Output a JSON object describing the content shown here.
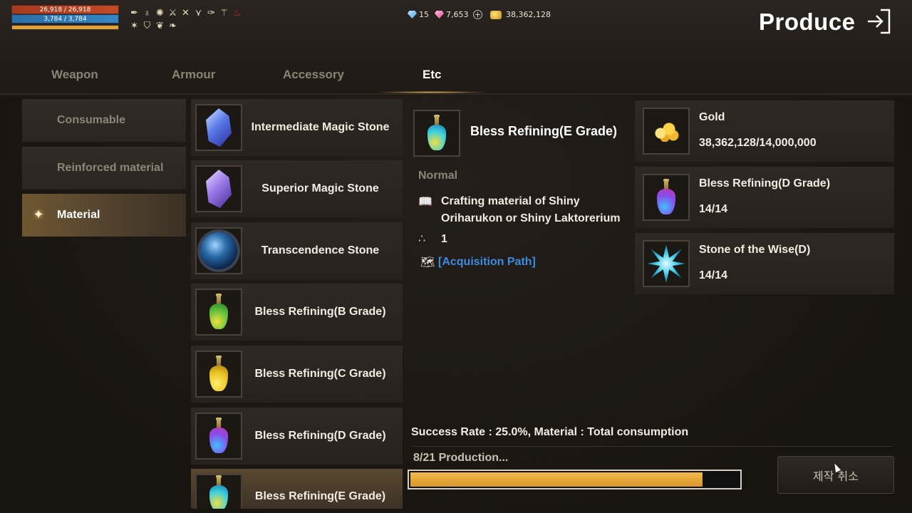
{
  "hud": {
    "hp_text": "26,918 / 26,918",
    "mp_text": "3,784 / 3,784",
    "xp_fill": 1.0,
    "hp_color": "#c24a26",
    "mp_color": "#3486c2",
    "xp_color": "#e0a23a",
    "buff_icons": [
      "quill-icon",
      "flask-icon",
      "sun-icon",
      "crossed-swords-icon",
      "x-wings-icon",
      "wing-icon",
      "feather-icon",
      "sword-icon",
      "potion-icon",
      "claw-icon",
      "shield-icon",
      "laurel-icon",
      "wings-icon"
    ]
  },
  "currency": {
    "blue_gem": "15",
    "pink_gem": "7,653",
    "gold": "38,362,128"
  },
  "header": {
    "title": "Produce"
  },
  "tabs": [
    {
      "label": "Weapon",
      "active": false
    },
    {
      "label": "Armour",
      "active": false
    },
    {
      "label": "Accessory",
      "active": false
    },
    {
      "label": "Etc",
      "active": true
    }
  ],
  "categories": [
    {
      "label": "Consumable",
      "active": false
    },
    {
      "label": "Reinforced material",
      "active": false
    },
    {
      "label": "Material",
      "active": true
    }
  ],
  "items": [
    {
      "name": "Intermediate Magic Stone",
      "icon": "blue-crystal-icon"
    },
    {
      "name": "Superior Magic Stone",
      "icon": "purple-crystal-icon"
    },
    {
      "name": "Transcendence Stone",
      "icon": "orb-icon"
    },
    {
      "name": "Bless Refining(B Grade)",
      "icon": "green-potion-icon"
    },
    {
      "name": "Bless Refining(C Grade)",
      "icon": "yellow-potion-icon"
    },
    {
      "name": "Bless Refining(D Grade)",
      "icon": "purple-potion-icon"
    },
    {
      "name": "Bless Refining(E Grade)",
      "icon": "cyan-potion-icon",
      "active": true
    }
  ],
  "detail": {
    "title": "Bless Refining(E Grade)",
    "grade": "Normal",
    "description_line1": "Crafting material of Shiny",
    "description_line2": "Oriharukon or Shiny Laktorerium",
    "quantity": "1",
    "acquisition": "[Acquisition Path]"
  },
  "requirements": [
    {
      "name": "Gold",
      "count": "38,362,128/14,000,000",
      "icon": "gold-pile-icon"
    },
    {
      "name": "Bless Refining(D Grade)",
      "count": "14/14",
      "icon": "purple-potion-icon"
    },
    {
      "name": "Stone of the Wise(D)",
      "count": "14/14",
      "icon": "spiked-star-icon"
    }
  ],
  "production": {
    "success_text": "Success Rate : 25.0%, Material : Total consumption",
    "status_text": "8/21 Production...",
    "progress": 0.89,
    "cancel_label": "제작 취소"
  }
}
